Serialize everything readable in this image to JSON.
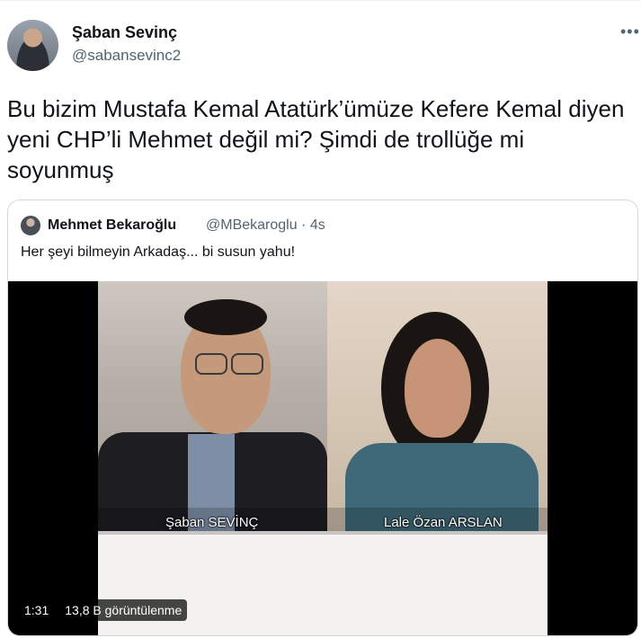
{
  "tweet": {
    "author_name": "Şaban Sevinç",
    "author_handle": "@sabansevinc2",
    "more_icon": "more-horizontal-icon",
    "text": "Bu bizim Mustafa Kemal Atatürk’ümüze Kefere Kemal diyen yeni CHP’li Mehmet değil mi? Şimdi de trollüğe mi soyunmuş"
  },
  "quoted_tweet": {
    "author_name": "Mehmet Bekaroğlu",
    "author_handle_time": "@MBekaroglu · 4s",
    "text": "Her şeyi bilmeyin Arkadaş... bi susun yahu!",
    "video": {
      "caption_left": "Şaban  SEVİNÇ",
      "caption_right": "Lale Özan ARSLAN",
      "duration": "1:31",
      "views": "13,8 B görüntülenme"
    }
  },
  "colors": {
    "text_primary": "#0f1419",
    "text_secondary": "#536471",
    "border": "#cfd9de"
  }
}
